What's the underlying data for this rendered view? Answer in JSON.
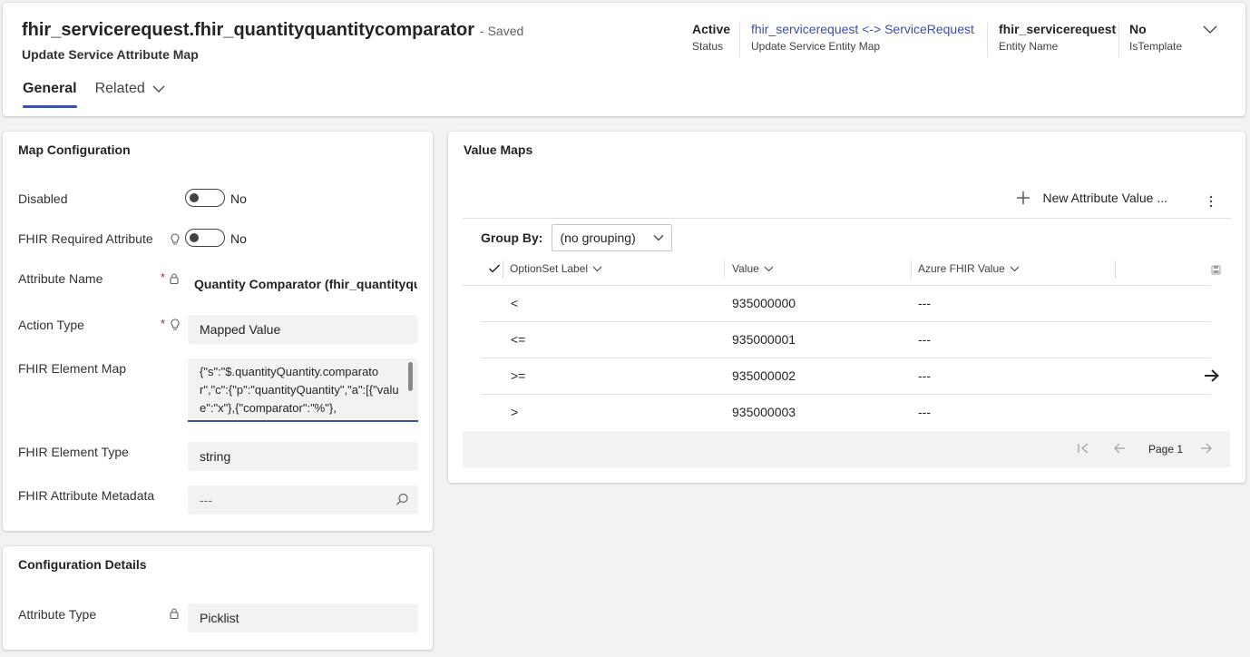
{
  "header": {
    "title": "fhir_servicerequest.fhir_quantityquantitycomparator",
    "saved": "- Saved",
    "subtitle": "Update Service Attribute Map",
    "fields": [
      {
        "value": "Active",
        "label": "Status"
      },
      {
        "value": "fhir_servicerequest <-> ServiceRequest",
        "label": "Update Service Entity Map"
      },
      {
        "value": "fhir_servicerequest",
        "label": "Entity Name"
      },
      {
        "value": "No",
        "label": "IsTemplate"
      }
    ],
    "tabs": [
      {
        "label": "General"
      },
      {
        "label": "Related"
      }
    ]
  },
  "map_config": {
    "title": "Map Configuration",
    "disabled": {
      "label": "Disabled",
      "value": "No"
    },
    "required": {
      "label": "FHIR Required Attribute",
      "value": "No"
    },
    "attribute_name": {
      "label": "Attribute Name",
      "value": "Quantity Comparator (fhir_quantityqua"
    },
    "action_type": {
      "label": "Action Type",
      "value": "Mapped Value"
    },
    "element_map": {
      "label": "FHIR Element Map",
      "value": "{\"s\":\"$.quantityQuantity.comparator\",\"c\":{\"p\":\"quantityQuantity\",\"a\":[{\"value\":\"x\"},{\"comparator\":\"%\"},"
    },
    "element_type": {
      "label": "FHIR Element Type",
      "value": "string"
    },
    "attr_metadata": {
      "label": "FHIR Attribute Metadata",
      "value": "---"
    }
  },
  "config_details": {
    "title": "Configuration Details",
    "attribute_type": {
      "label": "Attribute Type",
      "value": "Picklist"
    }
  },
  "value_maps": {
    "title": "Value Maps",
    "new_button": "New Attribute Value ...",
    "group_by_label": "Group By:",
    "group_by_value": "(no grouping)",
    "columns": [
      "OptionSet Label",
      "Value",
      "Azure FHIR Value"
    ],
    "rows": [
      {
        "label": "<",
        "value": "935000000",
        "fhir": "---"
      },
      {
        "label": "<=",
        "value": "935000001",
        "fhir": "---"
      },
      {
        "label": ">=",
        "value": "935000002",
        "fhir": "---"
      },
      {
        "label": ">",
        "value": "935000003",
        "fhir": "---"
      }
    ],
    "page_label": "Page 1"
  },
  "colors": {
    "accent": "#3b4fa8",
    "required": "#a4262c"
  }
}
